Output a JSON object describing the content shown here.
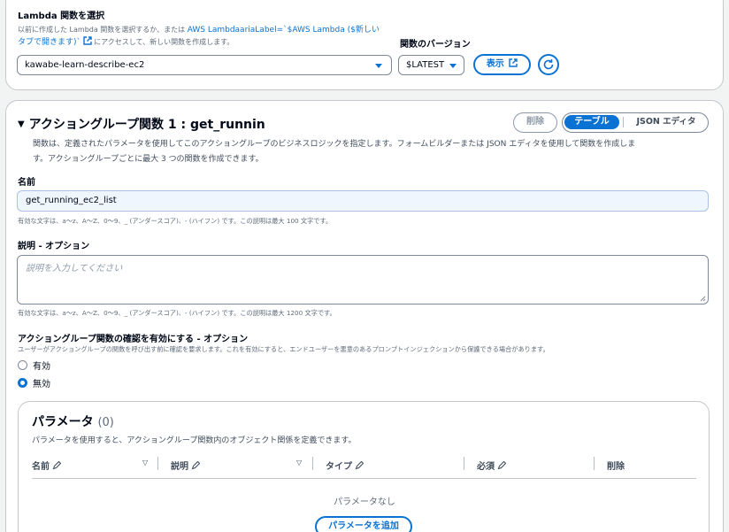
{
  "lambda_section": {
    "title": "Lambda 関数を選択",
    "help_line1_pre": "以前に作成した Lambda 関数を選択するか、または",
    "help_link_line1": "AWS LambdaariaLabel=`$AWS Lambda ($新しい",
    "help_link_line2": "タブで開きます)`",
    "help_line2_post": "にアクセスして、新しい関数を作成します。",
    "function_value": "kawabe-learn-describe-ec2",
    "version_label": "関数のバージョン",
    "version_value": "$LATEST",
    "show_button": "表示"
  },
  "action_group": {
    "title": "アクショングループ関数 1 : get_runnin",
    "delete_button": "削除",
    "segment_table": "テーブル",
    "segment_json": "JSON エディタ",
    "description_line1": "関数は、定義されたパラメータを使用してこのアクショングループのビジネスロジックを指定します。フォームビルダーまたは JSON エディタを使用して関数を作成しま",
    "description_line2": "す。アクショングループごとに最大 3 つの関数を作成できます。",
    "name_label": "名前",
    "name_value": "get_running_ec2_list",
    "name_hint": "有効な文字は、a〜z、A〜Z、0〜9、_ (アンダースコア)、- (ハイフン) です。この説明は最大 100 文字です。",
    "desc_label": "説明 - オプション",
    "desc_placeholder": "説明を入力してください",
    "desc_hint": "有効な文字は、a〜z、A〜Z、0〜9、_ (アンダースコア)、- (ハイフン) です。この説明は最大 1200 文字です。",
    "confirm_label": "アクショングループ関数の確認を有効にする - オプション",
    "confirm_hint": "ユーザーがアクショングループの関数を呼び出す前に確認を要求します。これを有効にすると、エンドユーザーを悪意のあるプロンプトインジェクションから保護できる場合があります。",
    "radio_enabled": "有効",
    "radio_disabled": "無効",
    "selected_radio": "無効"
  },
  "parameters": {
    "title": "パラメータ",
    "count": "(0)",
    "description": "パラメータを使用すると、アクショングループ関数内のオブジェクト関係を定義できます。",
    "columns": [
      "名前",
      "説明",
      "タイプ",
      "必須",
      "削除"
    ],
    "empty_text": "パラメータなし",
    "add_button": "パラメータを追加"
  },
  "colors": {
    "accent": "#0972d3",
    "border": "#7d8998",
    "text": "#000716",
    "muted": "#5f6b7a",
    "input_fill": "#f0f6fd"
  }
}
